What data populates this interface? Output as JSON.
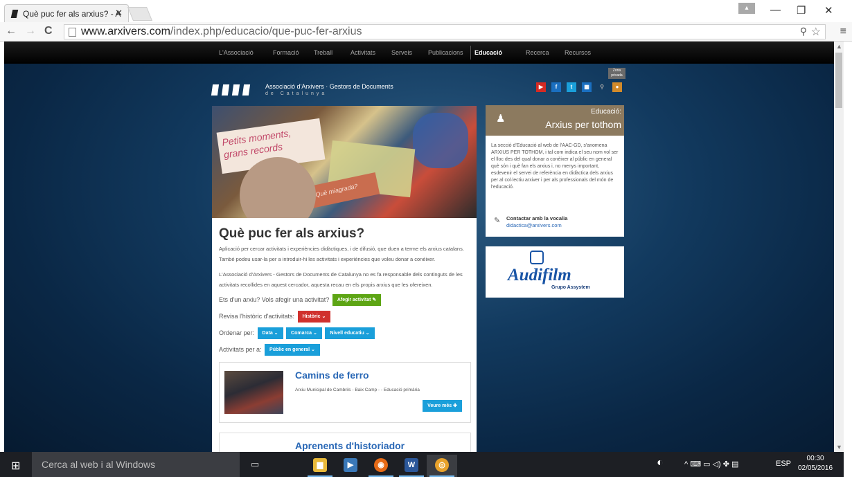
{
  "browser": {
    "tab_title": "Què puc fer als arxius? - A",
    "url_host": "www.arxivers.com",
    "url_path": "/index.php/educacio/que-puc-fer-arxius",
    "zoom_icon": "zoom-icon",
    "bookmark_icon": "star-icon",
    "menu_icon": "hamburger-icon"
  },
  "site_nav": {
    "items": [
      "L'Associació",
      "Formació",
      "Treball",
      "Activitats",
      "Serveis",
      "Publicacions",
      "Educació",
      "Recerca",
      "Recursos"
    ],
    "active": "Educació"
  },
  "header": {
    "org_name": "Associació d'Arxivers · Gestors de Documents",
    "org_region": "de Catalunya",
    "private_zone": "Zona privada",
    "social": [
      "youtube",
      "facebook",
      "twitter",
      "calendar",
      "search",
      "user"
    ]
  },
  "hero": {
    "card_text": "Petits moments, grans records",
    "card_text2": "Què miagrada?"
  },
  "main": {
    "title": "Què puc fer als arxius?",
    "intro": "Aplicació per cercar activitats i experiències didàctiques, i de difusió, que duen a terme els arxius catalans. També podeu usar-la per a introduir-hi les activitats i experiències que voleu donar a conèixer.",
    "disclaimer": "L'Associació d'Arxivers - Gestors de Documents de Catalunya no es fa responsable dels continguts de les activitats recollides en aquest cercador, aquesta recau en els propis arxius que les ofereixen.",
    "add_prompt": "Ets d'un arxiu? Vols afegir una activitat?",
    "add_button": "Afegir activitat ✎",
    "history_prompt": "Revisa l'històric d'activitats:",
    "history_button": "Històric ⌄",
    "order_prompt": "Ordenar per:",
    "order_buttons": [
      "Data ⌄",
      "Comarca ⌄",
      "Nivell educatiu ⌄"
    ],
    "audience_prompt": "Activitats per a:",
    "audience_button": "Públic en general ⌄"
  },
  "activities": [
    {
      "title": "Camins de ferro",
      "meta": "Arxiu Municipal de Cambrils - Baix Camp - - Educació primària",
      "more": "Veure més ✚"
    },
    {
      "title": "Aprenents d'historiador"
    }
  ],
  "sidebar": {
    "section_label": "Educació:",
    "section_title": "Arxius per tothom",
    "description": "La secció d'Educació al web de l'AAC-GD, s'anomena ARXIUS PER TOTHOM, i tal com indica el seu nom vol ser el lloc des del qual donar a conèixer al públic en general què són i què fan els arxius i, no menys important, esdevenir el servei de referència en didàctica dels arxius per al col·lectiu arxiver i per als professionals del món de l'educació.",
    "contact_label": "Contactar amb la vocalia",
    "contact_email": "didactica@arxivers.com",
    "sponsor_name": "Audifilm",
    "sponsor_sub": "Grupo Assystem"
  },
  "taskbar": {
    "search_placeholder": "Cerca al web i al Windows",
    "language": "ESP",
    "time": "00:30",
    "date": "02/05/2016",
    "apps": [
      "file-explorer",
      "media-player",
      "firefox",
      "word",
      "chrome"
    ]
  },
  "colors": {
    "nav_bg": "#000000",
    "accent_green": "#5da514",
    "accent_red": "#d0312d",
    "accent_blue": "#1a9fda",
    "edu_brown": "#8c7a5f",
    "link_blue": "#2a68b6"
  }
}
